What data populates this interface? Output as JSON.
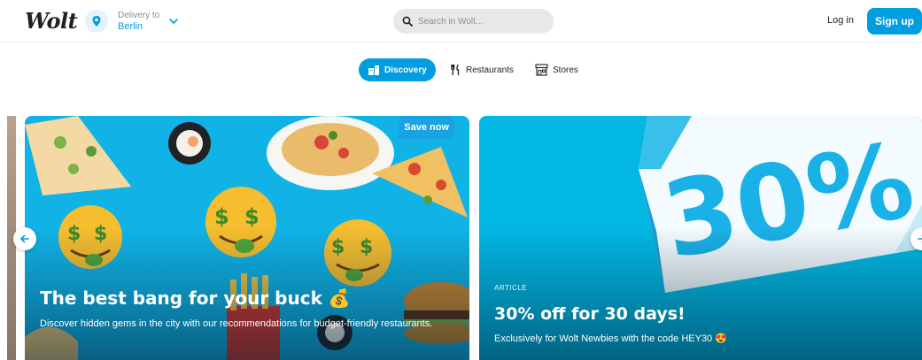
{
  "header": {
    "logo": "Wolt",
    "delivery_label": "Delivery to",
    "delivery_city": "Berlin",
    "search_placeholder": "Search in Wolt...",
    "login_label": "Log in",
    "signup_label": "Sign up"
  },
  "tabs": [
    {
      "label": "Discovery",
      "icon": "building-icon",
      "active": true
    },
    {
      "label": "Restaurants",
      "icon": "fork-knife-icon",
      "active": false
    },
    {
      "label": "Stores",
      "icon": "store-icon",
      "active": false
    }
  ],
  "cards": [
    {
      "badge": "Save now",
      "title": "The best bang for your buck 💰",
      "description": "Discover hidden gems in the city with our recommendations for budget-friendly restaurants."
    },
    {
      "eyebrow": "ARTICLE",
      "title": "30% off for 30 days!",
      "description": "Exclusively for Wolt Newbies with the code HEY30 😍",
      "image_text": "30%"
    }
  ],
  "colors": {
    "accent": "#009de0",
    "card_bg_1": "#11b3e6",
    "card_bg_2": "#02b8e3"
  }
}
